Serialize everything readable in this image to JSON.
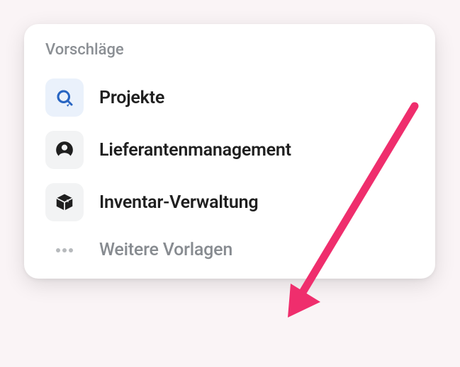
{
  "card": {
    "heading": "Vorschläge",
    "items": [
      {
        "label": "Projekte",
        "icon": "refresh-search",
        "highlight": true
      },
      {
        "label": "Lieferantenmanagement",
        "icon": "person",
        "highlight": false
      },
      {
        "label": "Inventar-Verwaltung",
        "icon": "box",
        "highlight": false
      }
    ],
    "more": {
      "label": "Weitere Vorlagen"
    }
  },
  "annotation": {
    "type": "arrow",
    "color": "#ef2e6d"
  }
}
